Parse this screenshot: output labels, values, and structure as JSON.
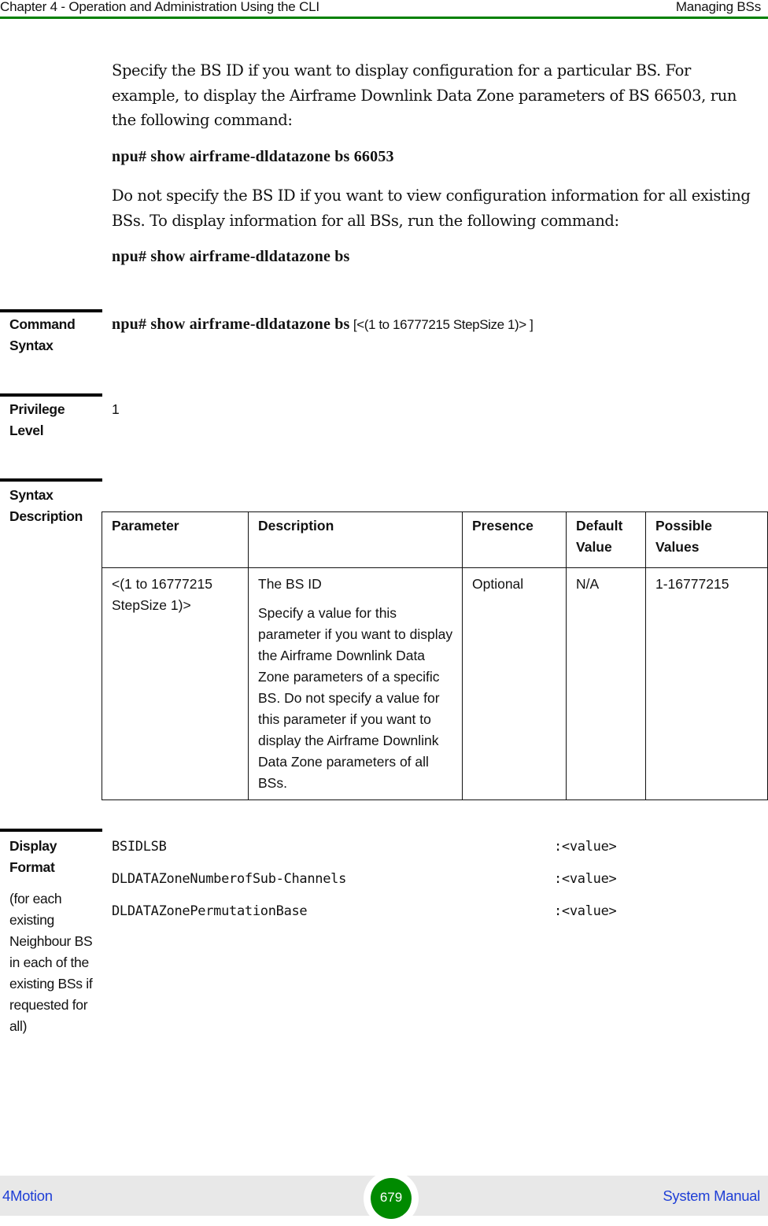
{
  "header": {
    "chapter_title": "Chapter 4 - Operation and Administration Using the CLI",
    "section_title": "Managing BSs",
    "accent_color": "#008000"
  },
  "intro": {
    "paragraph1": "Specify the BS ID if you want to display configuration for a particular BS. For example, to display the Airframe Downlink Data Zone parameters of BS 66503, run the following command:",
    "command1": "npu# show airframe-dldatazone bs 66053",
    "paragraph2": "Do not specify the BS ID if you want to view configuration information for all existing BSs. To display information for all BSs, run the following command:",
    "command2": "npu# show airframe-dldatazone bs"
  },
  "command_syntax": {
    "label_line1": "Command",
    "label_line2": "Syntax",
    "command": "npu# show airframe-dldatazone bs",
    "arguments": " [<(1 to 16777215 StepSize 1)> ]"
  },
  "privilege_level": {
    "label_line1": "Privilege",
    "label_line2": "Level",
    "value": "1"
  },
  "syntax_description": {
    "label_line1": "Syntax",
    "label_line2": "Description",
    "columns": [
      "Parameter",
      "Description",
      "Presence",
      "Default Value",
      "Possible Values"
    ],
    "rows": [
      {
        "parameter": "<(1 to 16777215 StepSize 1)>",
        "description_title": "The BS ID",
        "description_body": "Specify a value for this parameter if you want to display the Airframe Downlink Data Zone parameters of a specific BS. Do not specify a value for this parameter if you want to display the Airframe Downlink Data Zone parameters of all BSs.",
        "presence": "Optional",
        "default_value": "N/A",
        "possible_values": "1-16777215"
      }
    ]
  },
  "display_format": {
    "label_line1": "Display",
    "label_line2": "Format",
    "note": "(for each existing Neighbour BS in each of the existing BSs if requested for all)",
    "lines": [
      {
        "key": "BSIDLSB",
        "value": ":<value>"
      },
      {
        "key": "DLDATAZoneNumberofSub-Channels",
        "value": ":<value>"
      },
      {
        "key": "DLDATAZonePermutationBase",
        "value": ":<value>"
      }
    ]
  },
  "footer": {
    "product": "4Motion",
    "page_number": "679",
    "doc_title": "System Manual",
    "link_color": "#1f3fd6",
    "badge_color": "#008a00"
  }
}
